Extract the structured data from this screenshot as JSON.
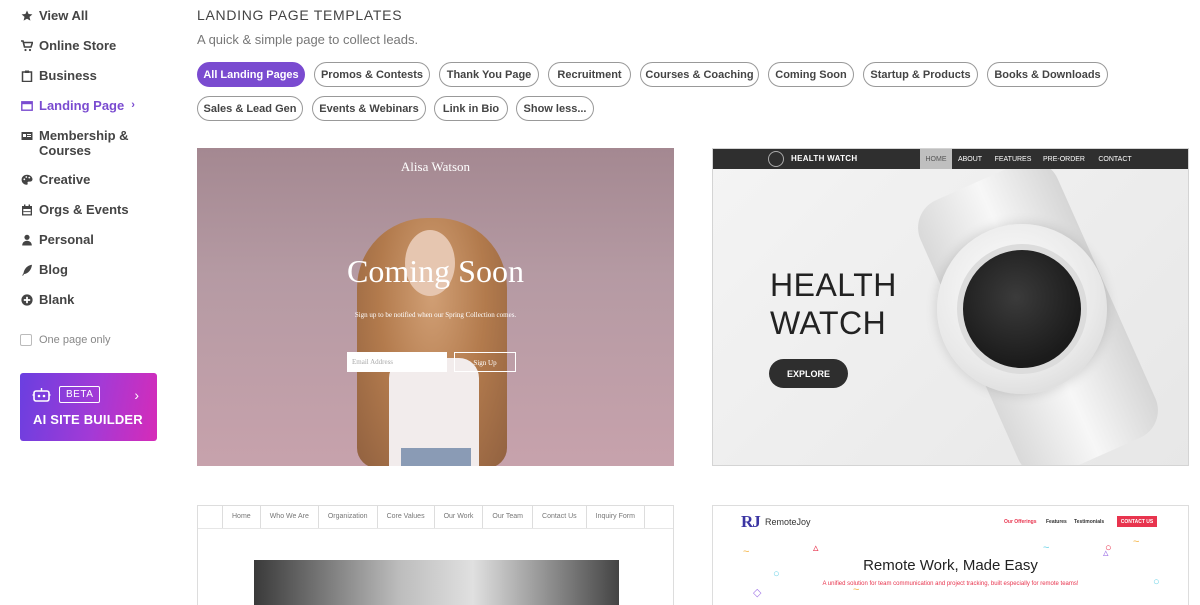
{
  "sidebar": {
    "items": [
      {
        "label": "View All",
        "icon": "star-icon"
      },
      {
        "label": "Online Store",
        "icon": "cart-icon"
      },
      {
        "label": "Business",
        "icon": "clipboard-icon"
      },
      {
        "label": "Landing Page",
        "icon": "browser-window-icon",
        "active": true
      },
      {
        "label": "Membership &",
        "label2": "Courses",
        "icon": "id-card-icon"
      },
      {
        "label": "Creative",
        "icon": "palette-icon"
      },
      {
        "label": "Orgs & Events",
        "icon": "calendar-icon"
      },
      {
        "label": "Personal",
        "icon": "person-icon"
      },
      {
        "label": "Blog",
        "icon": "quill-icon"
      },
      {
        "label": "Blank",
        "icon": "plus-circle-icon"
      }
    ],
    "one_page_only": "One page only",
    "ai_builder": {
      "badge": "BETA",
      "title": "AI SITE BUILDER"
    }
  },
  "header": {
    "title": "LANDING PAGE TEMPLATES",
    "subtitle": "A quick & simple page to collect leads."
  },
  "chips": [
    "All Landing Pages",
    "Promos & Contests",
    "Thank You Page",
    "Recruitment",
    "Courses & Coaching",
    "Coming Soon",
    "Startup & Products",
    "Books & Downloads",
    "Sales & Lead Gen",
    "Events & Webinars",
    "Link in Bio",
    "Show less..."
  ],
  "templates": {
    "coming_soon": {
      "name": "Alisa Watson",
      "heading": "Coming Soon",
      "tagline": "Sign up to be notified when our Spring Collection comes.",
      "email_placeholder": "Email Address",
      "signup": "Sign Up"
    },
    "health_watch": {
      "brand": "HEALTH WATCH",
      "menu": [
        "HOME",
        "ABOUT",
        "FEATURES",
        "PRE-ORDER",
        "CONTACT"
      ],
      "heading_line1": "HEALTH",
      "heading_line2": "WATCH",
      "cta": "EXPLORE"
    },
    "org": {
      "menu": [
        "Home",
        "Who We Are",
        "Organization",
        "Core Values",
        "Our Work",
        "Our Team",
        "Contact Us",
        "Inquiry Form"
      ]
    },
    "remotejoy": {
      "logo": "RJ",
      "brand": "RemoteJoy",
      "menu": [
        "Our Offerings",
        "Features",
        "Testimonials"
      ],
      "contact": "CONTACT US",
      "heading": "Remote Work, Made Easy",
      "sub": "A unified solution for team communication and project tracking, built especially for remote teams!"
    }
  },
  "colors": {
    "accent": "#7a4bd0",
    "ai_gradient_start": "#6a3fe0",
    "ai_gradient_end": "#d62bb8"
  }
}
